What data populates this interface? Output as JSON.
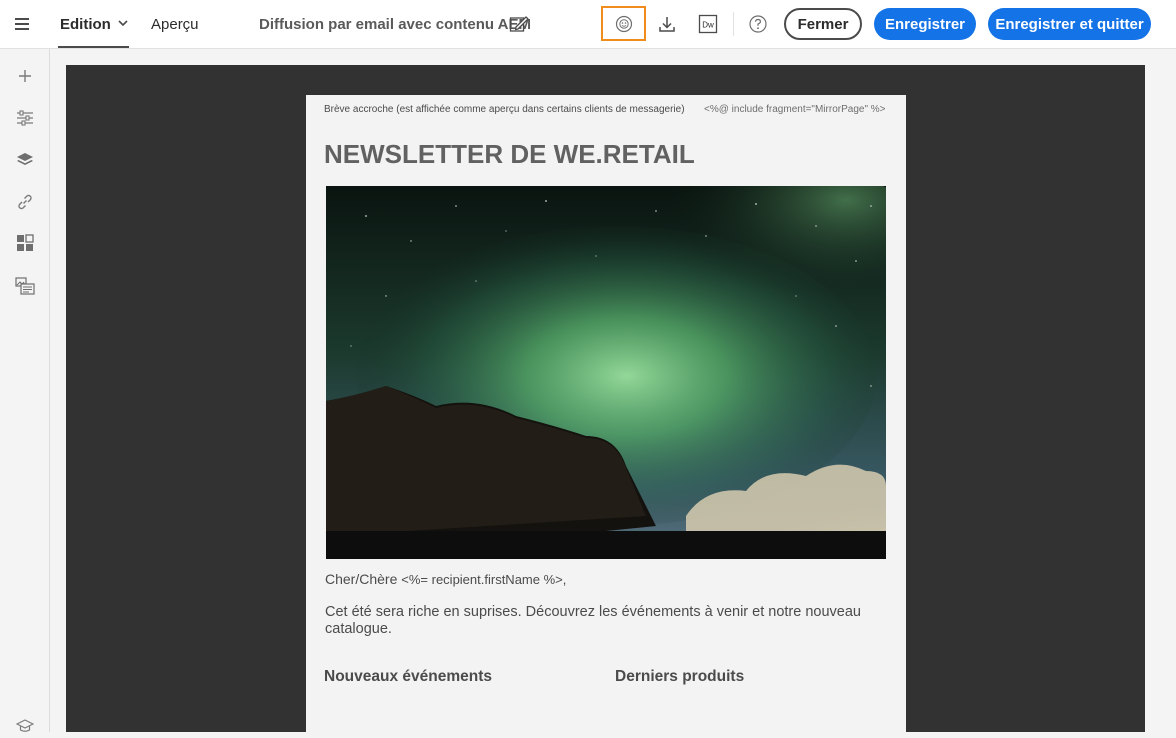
{
  "topbar": {
    "menu_icon": "hamburger-menu-icon",
    "tab_edition": "Edition",
    "tab_apercu": "Aperçu",
    "document_title": "Diffusion par email avec contenu AEM",
    "edit_icon": "edit-pencil-icon",
    "highlight_icon": "sprite-face-icon",
    "download_icon": "download-icon",
    "dw_icon_label": "Dw",
    "help_icon": "help-circle-icon",
    "fermer_label": "Fermer",
    "enregistrer_label": "Enregistrer",
    "enregistrer_quitter_label": "Enregistrer et quitter",
    "highlight_color": "#f08c1c",
    "primary_color": "#1473e6"
  },
  "leftrail": {
    "items": [
      {
        "icon": "add-icon"
      },
      {
        "icon": "sliders-icon"
      },
      {
        "icon": "layers-icon"
      },
      {
        "icon": "link-icon"
      },
      {
        "icon": "layout-grid-icon"
      },
      {
        "icon": "image-text-icon"
      },
      {
        "icon": "graduation-cap-icon"
      }
    ]
  },
  "email": {
    "preheader": "Brève accroche (est affichée comme aperçu dans certains clients de messagerie)",
    "mirror_include": "<%@ include fragment=\"MirrorPage\" %>",
    "title": "NEWSLETTER DE WE.RETAIL",
    "hero_image": "aurora-borealis-night-sky",
    "salutation_text": "Cher/Chère",
    "salutation_code": "<%= recipient.firstName %>,",
    "body": "Cet été sera riche en suprises. Découvrez les événements à venir et notre nouveau catalogue.",
    "col_left_heading": "Nouveaux événements",
    "col_right_heading": "Derniers produits"
  }
}
